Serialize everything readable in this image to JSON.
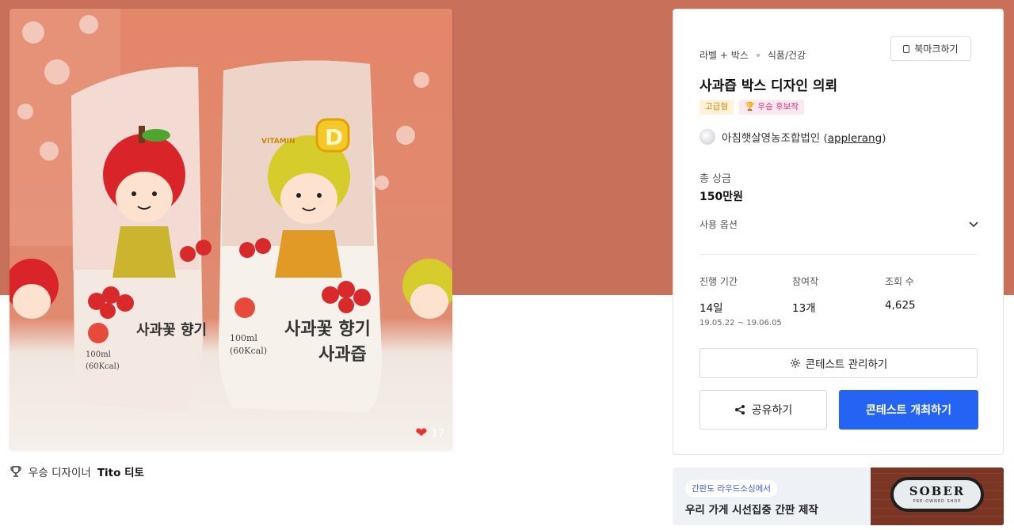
{
  "product": {
    "likes": "17",
    "package_text_1": "사과꽃 향기",
    "package_text_2": "사과즙",
    "package_volume": "100ml",
    "package_kcal": "(60Kcal)",
    "vitamin_label": "VITAMIN",
    "vitamin_letter": "D"
  },
  "designer": {
    "label": "우승 디자이너",
    "name": "Tito 티토"
  },
  "contest": {
    "category_1": "라벨 + 박스",
    "category_2": "식품/건강",
    "bookmark_label": "북마크하기",
    "title": "사과즙 박스 디자인 의뢰",
    "badge_premium": "고급형",
    "badge_winner": "우승 후보작",
    "host_name": "아침햇살영농조합법인 (",
    "host_handle": "applerang",
    "host_close": ")",
    "prize_label": "총 상금",
    "prize_value": "150만원",
    "options_label": "사용 옵션",
    "stats": {
      "period_label": "진행 기간",
      "period_value": "14일",
      "period_dates": "19.05.22  ~  19.06.05",
      "entries_label": "참여작",
      "entries_value": "13개",
      "views_label": "조회 수",
      "views_value": "4,625"
    },
    "manage_label": "콘테스트 관리하기",
    "share_label": "공유하기",
    "host_button_label": "콘테스트 개최하기"
  },
  "ad": {
    "tag": "간판도 라우드소싱에서",
    "text": "우리 가게 시선집중 간판 제작",
    "sign_brand": "SOBER",
    "sign_sub": "PRE-OWNED SHOP"
  },
  "colors": {
    "hero_band": "#c9705a",
    "primary_button": "#2463f4",
    "heart": "#e8322f"
  }
}
